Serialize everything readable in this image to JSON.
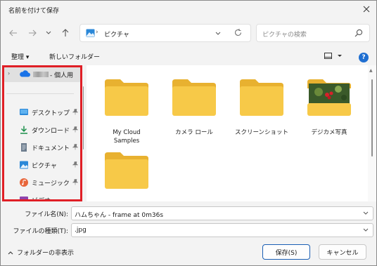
{
  "window": {
    "title": "名前を付けて保存"
  },
  "nav": {
    "address_location": "ピクチャ",
    "search_placeholder": "ピクチャの検索"
  },
  "toolbar": {
    "organize": "整理 ▾",
    "new_folder": "新しいフォルダー",
    "help": "?"
  },
  "sidebar": {
    "account_label": "- 個人用",
    "items": [
      {
        "label": "デスクトップ",
        "icon": "desktop-icon"
      },
      {
        "label": "ダウンロード",
        "icon": "download-icon"
      },
      {
        "label": "ドキュメント",
        "icon": "document-icon"
      },
      {
        "label": "ピクチャ",
        "icon": "pictures-icon"
      },
      {
        "label": "ミュージック",
        "icon": "music-icon"
      },
      {
        "label": "ビデオ",
        "icon": "video-icon"
      }
    ]
  },
  "folders": [
    {
      "name": "My Cloud\nSamples"
    },
    {
      "name": "カメラ ロール"
    },
    {
      "name": "スクリーンショット"
    },
    {
      "name": "デジカメ写真"
    },
    {
      "name": ""
    }
  ],
  "footer": {
    "filename_label": "ファイル名(N):",
    "filename_value": "ハムちゃん - frame at 0m36s",
    "filetype_label": "ファイルの種類(T):",
    "filetype_value": ".jpg",
    "hide_folders": "フォルダーの非表示",
    "save_label": "保存(S)",
    "cancel_label": "キャンセル"
  },
  "colors": {
    "accent": "#1f6fd1",
    "highlight": "#e01f26",
    "folder": "#f7c948"
  }
}
